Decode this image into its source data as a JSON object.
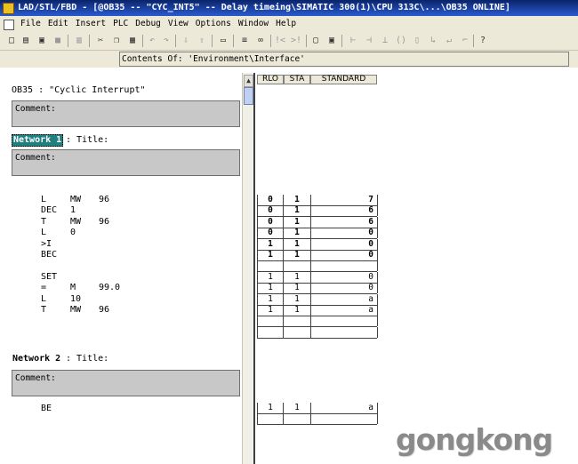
{
  "window": {
    "title": "LAD/STL/FBD  - [@OB35 -- \"CYC_INT5\" -- Delay timeing\\SIMATIC 300(1)\\CPU 313C\\...\\OB35  ONLINE]"
  },
  "menu": [
    "File",
    "Edit",
    "Insert",
    "PLC",
    "Debug",
    "View",
    "Options",
    "Window",
    "Help"
  ],
  "info": {
    "contents": "Contents Of: 'Environment\\Interface'"
  },
  "block": {
    "header": "OB35 :  \"Cyclic Interrupt\""
  },
  "comment_label": "Comment:",
  "network1": {
    "label": "Network 1",
    "title_label": ": Title:"
  },
  "network2": {
    "label": "Network 2",
    "title_label": ": Title:"
  },
  "status_headers": [
    "RLO",
    "STA",
    "STANDARD"
  ],
  "statements1": [
    {
      "op": "L",
      "operand": "MW",
      "addr": "96",
      "rlo": "0",
      "sta": "1",
      "std": "7",
      "bold": true
    },
    {
      "op": "DEC",
      "operand": "1",
      "addr": "",
      "rlo": "0",
      "sta": "1",
      "std": "6",
      "bold": true
    },
    {
      "op": "T",
      "operand": "MW",
      "addr": "96",
      "rlo": "0",
      "sta": "1",
      "std": "6",
      "bold": true
    },
    {
      "op": "L",
      "operand": "0",
      "addr": "",
      "rlo": "0",
      "sta": "1",
      "std": "0",
      "bold": true
    },
    {
      "op": ">I",
      "operand": "",
      "addr": "",
      "rlo": "1",
      "sta": "1",
      "std": "0",
      "bold": true
    },
    {
      "op": "BEC",
      "operand": "",
      "addr": "",
      "rlo": "1",
      "sta": "1",
      "std": "0",
      "bold": true
    },
    {
      "op": "",
      "operand": "",
      "addr": "",
      "rlo": "",
      "sta": "",
      "std": "",
      "bold": false
    },
    {
      "op": "SET",
      "operand": "",
      "addr": "",
      "rlo": "1",
      "sta": "1",
      "std": "0",
      "bold": false
    },
    {
      "op": "=",
      "operand": "M",
      "addr": "99.0",
      "rlo": "1",
      "sta": "1",
      "std": "0",
      "bold": false
    },
    {
      "op": "L",
      "operand": "10",
      "addr": "",
      "rlo": "1",
      "sta": "1",
      "std": "a",
      "bold": false
    },
    {
      "op": "T",
      "operand": "MW",
      "addr": "96",
      "rlo": "1",
      "sta": "1",
      "std": "a",
      "bold": false
    }
  ],
  "statements2": [
    {
      "op": "BE",
      "operand": "",
      "addr": "",
      "rlo": "1",
      "sta": "1",
      "std": "a",
      "bold": false
    }
  ],
  "watermark": "gongkong"
}
